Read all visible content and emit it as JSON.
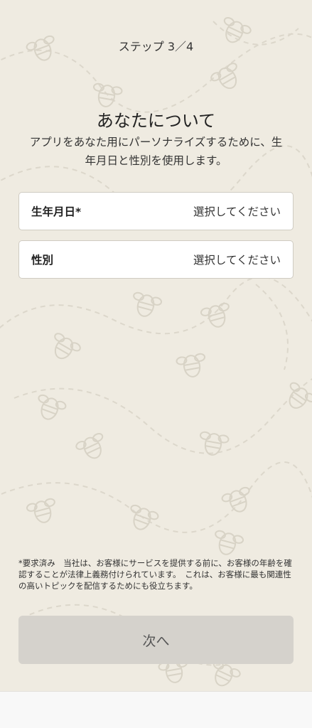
{
  "header": {
    "step": "ステップ 3／4"
  },
  "main": {
    "title": "あなたについて",
    "subtitle": "アプリをあなた用にパーソナライズするために、生年月日と性別を使用します。",
    "fields": [
      {
        "label": "生年月日*",
        "value": "選択してください"
      },
      {
        "label": "性別",
        "value": "選択してください"
      }
    ],
    "note": "*要求済み　当社は、お客様にサービスを提供する前に、お客様の年齢を確認することが法律上義務付けられています。　これは、お客様に最も関連性の高いトピックを配信するためにも役立ちます。"
  },
  "footer": {
    "next_label": "次へ"
  },
  "colors": {
    "background": "#efebe1",
    "field_bg": "#ffffff",
    "button_disabled": "#d5d2cc",
    "pattern": "#ddd8cc"
  },
  "icons": {
    "background_pattern": "bee-icon"
  }
}
